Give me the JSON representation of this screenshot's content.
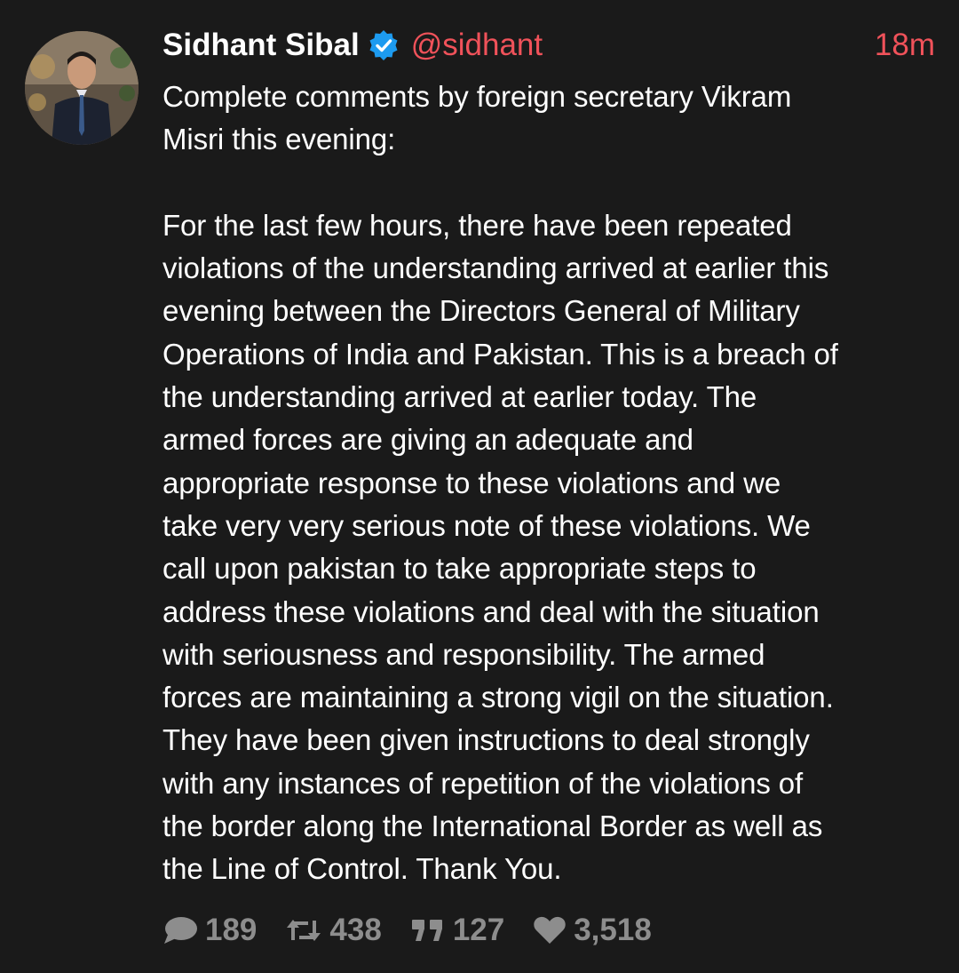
{
  "tweet": {
    "author_name": "Sidhant Sibal",
    "verified": true,
    "handle": "@sidhant",
    "time": "18m",
    "text": "Complete comments by foreign secretary Vikram\nMisri this evening:\n\nFor the last few hours, there have been repeated\nviolations of the understanding arrived at earlier this\nevening between the Directors General of Military\nOperations of India and Pakistan. This is a breach of\nthe understanding arrived at earlier today. The\narmed forces are giving an adequate and\nappropriate response to these violations and we\ntake very very serious note of these violations. We\ncall upon pakistan to take appropriate steps to\naddress these violations and deal with the situation\nwith seriousness and responsibility. The armed\nforces are maintaining a strong vigil on the situation.\nThey have been given instructions to deal strongly\nwith any instances of repetition of the violations of\nthe border along the International Border as well as\nthe Line of Control. Thank You.",
    "stats": {
      "replies": "189",
      "retweets": "438",
      "quotes": "127",
      "likes": "3,518"
    }
  },
  "icons": {
    "verified": "verified-badge-icon",
    "reply": "speech-bubble-icon",
    "retweet": "retweet-icon",
    "quote": "quote-icon",
    "like": "heart-icon"
  },
  "colors": {
    "background": "#1a1a1a",
    "accent": "#f0525a",
    "verified": "#1d9bf0",
    "muted": "#8d8d8d"
  }
}
